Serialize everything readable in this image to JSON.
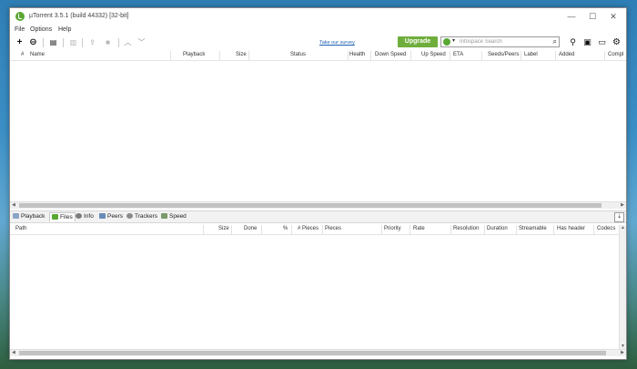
{
  "window": {
    "title": "µTorrent 3.5.1  (build 44332) [32-bit]",
    "controls": {
      "minimize": "—",
      "maximize": "☐",
      "close": "✕"
    }
  },
  "menu": [
    "File",
    "Options",
    "Help"
  ],
  "toolbar": {
    "add": "+",
    "add_link": "⊖",
    "create": "▤",
    "remove": "▥",
    "start": "⇪",
    "stop": "■",
    "up": "︿",
    "down": "﹀",
    "survey_link": "Take our survey",
    "upgrade": "Upgrade",
    "search_placeholder": "Infospace Search",
    "search_caret": "▾",
    "search_icon": "⌕",
    "right_icons": [
      "⚲",
      "▣",
      "▭",
      "⚙"
    ]
  },
  "torrent_columns": [
    "#",
    "Name",
    "Playback",
    "Size",
    "Status",
    "Health",
    "Down Speed",
    "Up Speed",
    "ETA",
    "Seeds/Peers",
    "Label",
    "Added",
    "Compl"
  ],
  "tabs": [
    {
      "label": "Playback",
      "color": "#8aa4c6"
    },
    {
      "label": "Files",
      "color": "#5aa832"
    },
    {
      "label": "Info",
      "color": "#7b7b7b"
    },
    {
      "label": "Peers",
      "color": "#6a8ab8"
    },
    {
      "label": "Trackers",
      "color": "#8a8a8a"
    },
    {
      "label": "Speed",
      "color": "#7a9a6a"
    }
  ],
  "active_tab": "Files",
  "collapse": "⇣",
  "file_columns": [
    "Path",
    "Size",
    "Done",
    "%",
    "# Pieces",
    "Pieces",
    "Priority",
    "Rate",
    "Resolution",
    "Duration",
    "Streamable",
    "Has header",
    "Codecs"
  ]
}
